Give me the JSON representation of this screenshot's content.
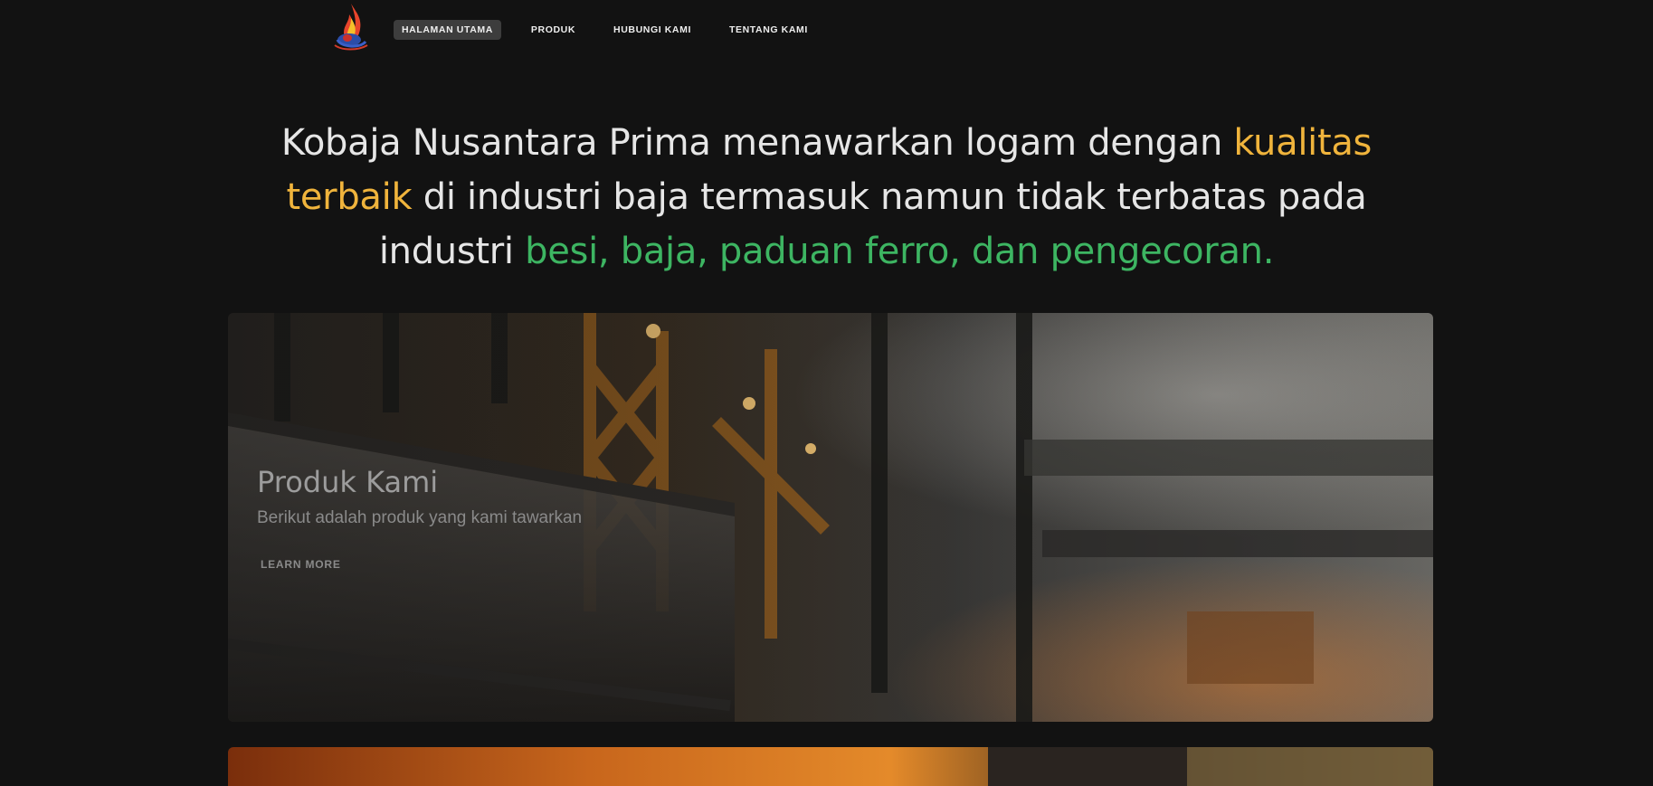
{
  "nav": {
    "items": [
      {
        "label": "HALAMAN UTAMA",
        "active": true
      },
      {
        "label": "PRODUK",
        "active": false
      },
      {
        "label": "HUBUNGI KAMI",
        "active": false
      },
      {
        "label": "TENTANG KAMI",
        "active": false
      }
    ]
  },
  "headline": {
    "part1": "Kobaja Nusantara Prima menawarkan logam dengan ",
    "highlight1": "kualitas terbaik",
    "part2": " di industri baja termasuk namun tidak terbatas pada industri ",
    "highlight2": "besi, baja, paduan ferro, dan pengecoran.",
    "highlight1_color": "#f0b43c",
    "highlight2_color": "#3db562"
  },
  "hero_card": {
    "title": "Produk Kami",
    "subtitle": "Berikut adalah produk yang kami tawarkan",
    "button": "LEARN MORE"
  },
  "colors": {
    "background": "#121212",
    "nav_active_bg": "#3d3d3d"
  }
}
